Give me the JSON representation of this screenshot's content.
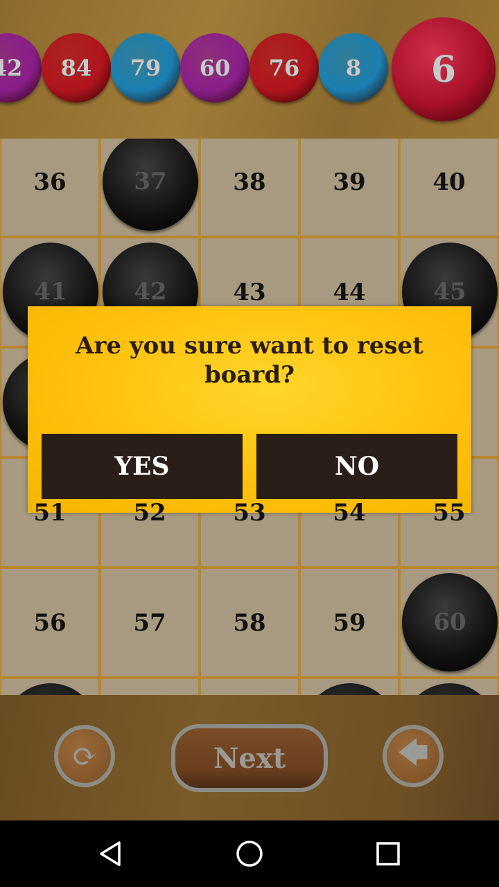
{
  "called_balls": [
    {
      "number": "42",
      "color": "#8a1e8a"
    },
    {
      "number": "84",
      "color": "#b0141c"
    },
    {
      "number": "79",
      "color": "#1a7fb0"
    },
    {
      "number": "60",
      "color": "#8a1e8a"
    },
    {
      "number": "76",
      "color": "#b0141c"
    },
    {
      "number": "8",
      "color": "#1a7fb0"
    }
  ],
  "current_ball": {
    "number": "6",
    "color": "#a8102a"
  },
  "board": {
    "rows": [
      [
        {
          "n": "36",
          "m": false
        },
        {
          "n": "37",
          "m": true
        },
        {
          "n": "38",
          "m": false
        },
        {
          "n": "39",
          "m": false
        },
        {
          "n": "40",
          "m": false
        }
      ],
      [
        {
          "n": "41",
          "m": true
        },
        {
          "n": "42",
          "m": true
        },
        {
          "n": "43",
          "m": false
        },
        {
          "n": "44",
          "m": false
        },
        {
          "n": "45",
          "m": true
        }
      ],
      [
        {
          "n": "",
          "m": true
        },
        {
          "n": "",
          "m": false
        },
        {
          "n": "",
          "m": false
        },
        {
          "n": "",
          "m": false
        },
        {
          "n": "",
          "m": false
        }
      ],
      [
        {
          "n": "51",
          "m": false
        },
        {
          "n": "52",
          "m": false
        },
        {
          "n": "53",
          "m": false
        },
        {
          "n": "54",
          "m": false
        },
        {
          "n": "55",
          "m": false
        }
      ],
      [
        {
          "n": "56",
          "m": false
        },
        {
          "n": "57",
          "m": false
        },
        {
          "n": "58",
          "m": false
        },
        {
          "n": "59",
          "m": false
        },
        {
          "n": "60",
          "m": true
        }
      ],
      [
        {
          "n": "",
          "m": true
        },
        {
          "n": "",
          "m": false
        },
        {
          "n": "",
          "m": false
        },
        {
          "n": "",
          "m": true
        },
        {
          "n": "",
          "m": true
        }
      ]
    ]
  },
  "controls": {
    "next_label": "Next",
    "reset_icon": "refresh-icon",
    "back_icon": "arrow-left-icon"
  },
  "dialog": {
    "message": "Are you sure want to reset board?",
    "yes_label": "YES",
    "no_label": "NO"
  },
  "navbar": {
    "back": "triangle-back-icon",
    "home": "circle-home-icon",
    "recents": "square-recents-icon"
  }
}
